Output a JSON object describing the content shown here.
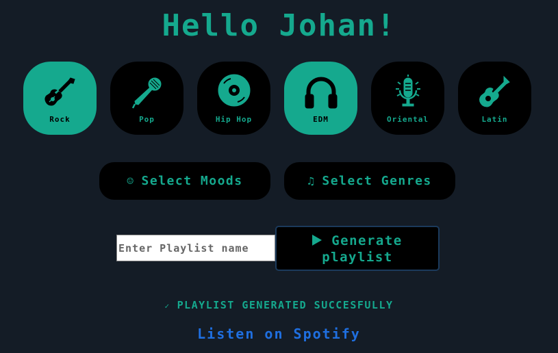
{
  "header": {
    "title": "Hello Johan!"
  },
  "genres": [
    {
      "label": "Rock",
      "icon": "electric-guitar-icon",
      "active": true
    },
    {
      "label": "Pop",
      "icon": "microphone-icon",
      "active": false
    },
    {
      "label": "Hip Hop",
      "icon": "vinyl-record-icon",
      "active": false
    },
    {
      "label": "EDM",
      "icon": "headphones-icon",
      "active": true
    },
    {
      "label": "Oriental",
      "icon": "oriental-microphone-icon",
      "active": false
    },
    {
      "label": "Latin",
      "icon": "acoustic-guitar-icon",
      "active": false
    }
  ],
  "actions": {
    "moods_label": "Select Moods",
    "moods_icon": "☺",
    "genres_label": "Select Genres",
    "genres_icon": "♫"
  },
  "playlist": {
    "name_placeholder": "Enter Playlist name",
    "name_value": "",
    "generate_label_line1": "Generate",
    "generate_label_line2": "playlist"
  },
  "status": {
    "check_icon": "✓",
    "message": "PLAYLIST GENERATED SUCCESFULLY",
    "listen_label": "Listen on Spotify"
  },
  "colors": {
    "background": "#141c26",
    "accent": "#15a98e",
    "link": "#1f6fe0",
    "button_bg": "#000000"
  }
}
